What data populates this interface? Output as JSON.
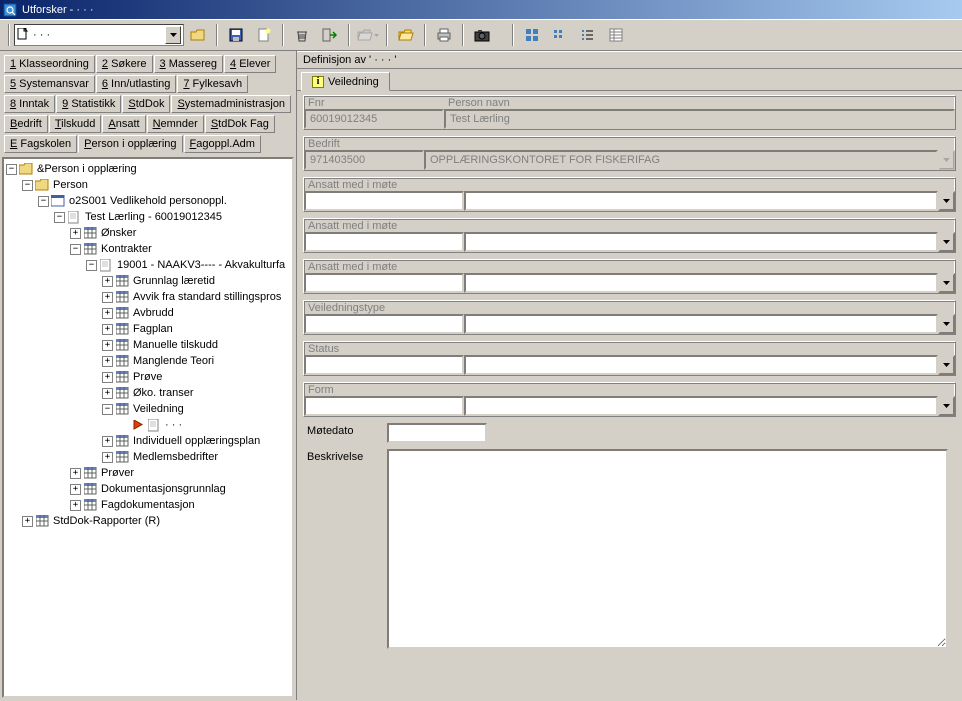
{
  "window": {
    "title": "Utforsker -  · · ·"
  },
  "toolbar": {
    "dropdown_label": "· · ·"
  },
  "left_tabs": {
    "row1": [
      "1 Klasseordning",
      "2 Søkere",
      "3 Massereg",
      "4 Elever"
    ],
    "row2": [
      "5 Systemansvar",
      "6 Inn/utlasting",
      "7 Fylkesavh"
    ],
    "row3": [
      "8 Inntak",
      "9 Statistikk",
      "StdDok",
      "Systemadministrasjon"
    ],
    "row4": [
      "Bedrift",
      "Tilskudd",
      "Ansatt",
      "Nemnder",
      "StdDok Fag"
    ],
    "row5": [
      "E Fagskolen",
      "Person i opplæring",
      "Fagoppl.Adm"
    ],
    "selected": "Person i opplæring"
  },
  "tree": [
    {
      "depth": 0,
      "tw": "-",
      "ico": "folder",
      "label": "&Person i opplæring"
    },
    {
      "depth": 1,
      "tw": "-",
      "ico": "folder",
      "label": "Person"
    },
    {
      "depth": 2,
      "tw": "-",
      "ico": "win",
      "label": "o2S001 Vedlikehold personoppl."
    },
    {
      "depth": 3,
      "tw": "-",
      "ico": "doc",
      "label": "Test Lærling - 60019012345"
    },
    {
      "depth": 4,
      "tw": "+",
      "ico": "grid",
      "label": "Ønsker"
    },
    {
      "depth": 4,
      "tw": "-",
      "ico": "grid",
      "label": "Kontrakter"
    },
    {
      "depth": 5,
      "tw": "-",
      "ico": "doc",
      "label": "19001 - NAAKV3---- - Akvakulturfa"
    },
    {
      "depth": 6,
      "tw": "+",
      "ico": "grid",
      "label": "Grunnlag læretid"
    },
    {
      "depth": 6,
      "tw": "+",
      "ico": "grid",
      "label": "Avvik fra standard stillingspros"
    },
    {
      "depth": 6,
      "tw": "+",
      "ico": "grid",
      "label": "Avbrudd"
    },
    {
      "depth": 6,
      "tw": "+",
      "ico": "grid",
      "label": "Fagplan"
    },
    {
      "depth": 6,
      "tw": "+",
      "ico": "grid",
      "label": "Manuelle tilskudd"
    },
    {
      "depth": 6,
      "tw": "+",
      "ico": "grid",
      "label": "Manglende Teori"
    },
    {
      "depth": 6,
      "tw": "+",
      "ico": "grid",
      "label": "Prøve"
    },
    {
      "depth": 6,
      "tw": "+",
      "ico": "grid",
      "label": "Øko. transer"
    },
    {
      "depth": 6,
      "tw": "-",
      "ico": "grid",
      "label": "Veiledning",
      "selected": false
    },
    {
      "depth": 7,
      "tw": "",
      "ico": "arrow",
      "label": "· · ·",
      "special": true
    },
    {
      "depth": 6,
      "tw": "+",
      "ico": "grid",
      "label": "Individuell opplæringsplan"
    },
    {
      "depth": 6,
      "tw": "+",
      "ico": "grid",
      "label": "Medlemsbedrifter"
    },
    {
      "depth": 4,
      "tw": "+",
      "ico": "grid",
      "label": "Prøver"
    },
    {
      "depth": 4,
      "tw": "+",
      "ico": "grid",
      "label": "Dokumentasjonsgrunnlag"
    },
    {
      "depth": 4,
      "tw": "+",
      "ico": "grid",
      "label": "Fagdokumentasjon"
    },
    {
      "depth": 1,
      "tw": "+",
      "ico": "grid",
      "label": "StdDok-Rapporter (R)"
    }
  ],
  "definition_bar": "Definisjon av ' · · · '",
  "right_tab": "Veiledning",
  "form": {
    "fnr_label": "Fnr",
    "fnr_value": "60019012345",
    "person_label": "Person navn",
    "person_value": "Test Lærling",
    "bedrift_label": "Bedrift",
    "bedrift_id": "971403500",
    "bedrift_name": "OPPLÆRINGSKONTORET FOR FISKERIFAG",
    "ansatt1": "Ansatt med i møte",
    "ansatt1_v": "",
    "ansatt1_n": "",
    "ansatt2": "Ansatt med i møte",
    "ansatt2_v": "",
    "ansatt2_n": "",
    "ansatt3": "Ansatt med i møte",
    "ansatt3_v": "",
    "ansatt3_n": "",
    "veiltype": "Veiledningstype",
    "veiltype_v": "",
    "veiltype_n": "",
    "status": "Status",
    "status_v": "",
    "status_n": "",
    "formlbl": "Form",
    "form_v": "",
    "form_n": "",
    "motedato": "Møtedato",
    "motedato_v": "",
    "beskrivelse": "Beskrivelse",
    "beskrivelse_v": ""
  }
}
